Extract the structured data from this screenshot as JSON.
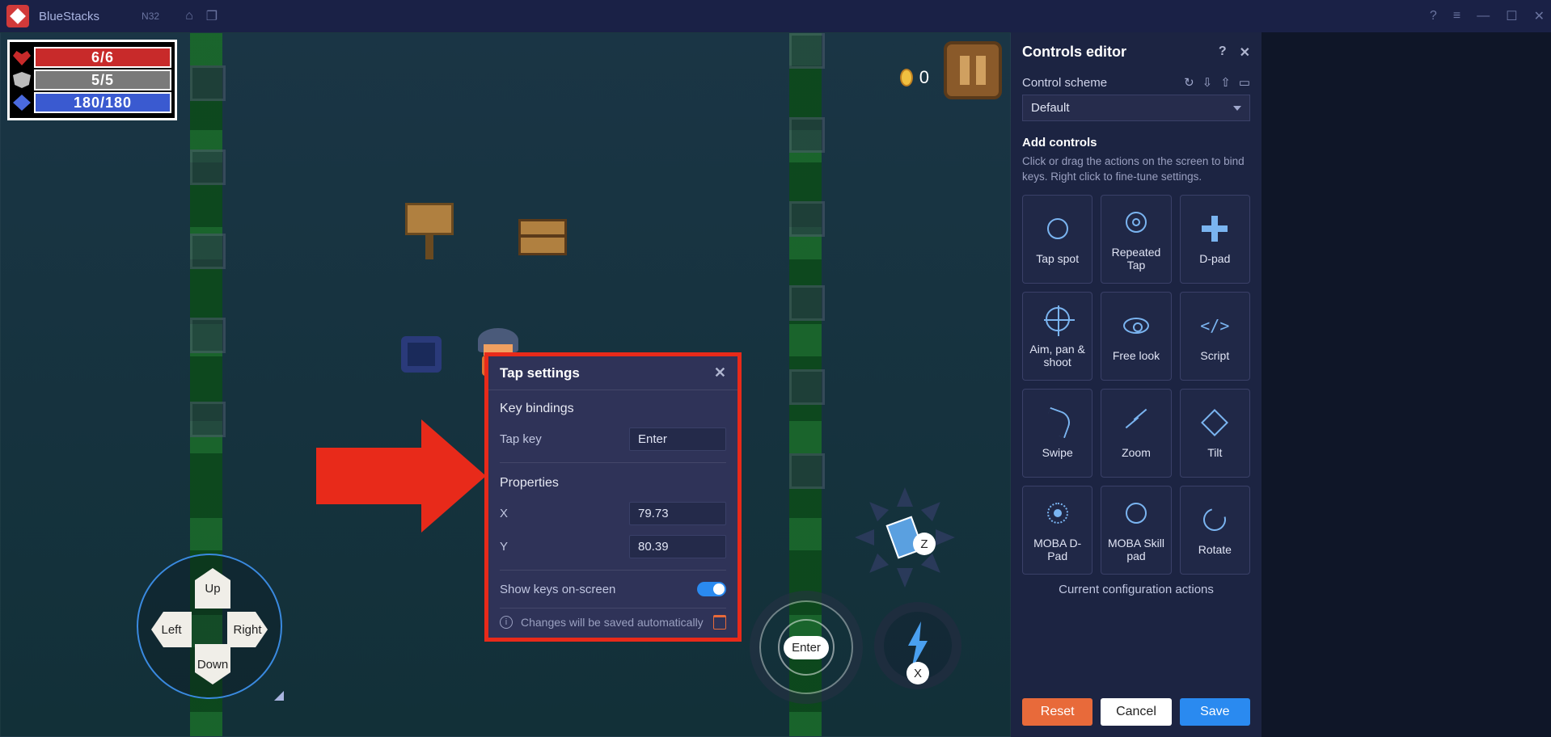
{
  "titlebar": {
    "app_name": "BlueStacks",
    "instance_badge": "N32"
  },
  "hud": {
    "hp": "6/6",
    "armor": "5/5",
    "mana": "180/180",
    "coins": "0"
  },
  "dpad": {
    "up": "Up",
    "down": "Down",
    "left": "Left",
    "right": "Right"
  },
  "action_buttons": {
    "enter": "Enter",
    "x": "X",
    "z": "Z"
  },
  "popup": {
    "title": "Tap settings",
    "section_bindings": "Key bindings",
    "tap_key_label": "Tap key",
    "tap_key_value": "Enter",
    "section_props": "Properties",
    "x_label": "X",
    "x_value": "79.73",
    "y_label": "Y",
    "y_value": "80.39",
    "show_keys_label": "Show keys on-screen",
    "footer_note": "Changes will be saved automatically"
  },
  "panel": {
    "title": "Controls editor",
    "scheme_label": "Control scheme",
    "scheme_value": "Default",
    "add_controls_label": "Add controls",
    "hint": "Click or drag the actions on the screen to bind keys. Right click to fine-tune settings.",
    "cards": {
      "tap_spot": "Tap spot",
      "repeated_tap": "Repeated Tap",
      "dpad": "D-pad",
      "aim_pan_shoot": "Aim, pan & shoot",
      "free_look": "Free look",
      "script": "Script",
      "swipe": "Swipe",
      "zoom": "Zoom",
      "tilt": "Tilt",
      "moba_dpad": "MOBA D-Pad",
      "moba_skill": "MOBA Skill pad",
      "rotate": "Rotate"
    },
    "config_actions_label": "Current configuration actions",
    "buttons": {
      "reset": "Reset",
      "cancel": "Cancel",
      "save": "Save"
    }
  }
}
